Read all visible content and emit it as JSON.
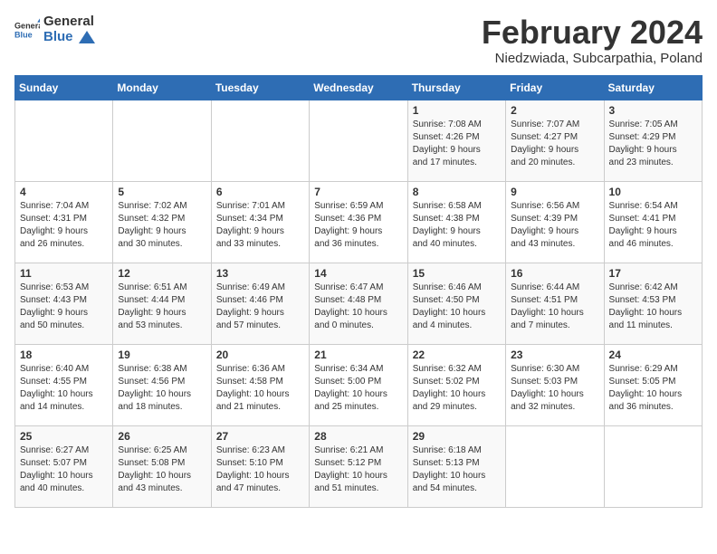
{
  "header": {
    "logo_general": "General",
    "logo_blue": "Blue",
    "month_year": "February 2024",
    "location": "Niedzwiada, Subcarpathia, Poland"
  },
  "days_of_week": [
    "Sunday",
    "Monday",
    "Tuesday",
    "Wednesday",
    "Thursday",
    "Friday",
    "Saturday"
  ],
  "weeks": [
    [
      {
        "day": "",
        "info": ""
      },
      {
        "day": "",
        "info": ""
      },
      {
        "day": "",
        "info": ""
      },
      {
        "day": "",
        "info": ""
      },
      {
        "day": "1",
        "info": "Sunrise: 7:08 AM\nSunset: 4:26 PM\nDaylight: 9 hours\nand 17 minutes."
      },
      {
        "day": "2",
        "info": "Sunrise: 7:07 AM\nSunset: 4:27 PM\nDaylight: 9 hours\nand 20 minutes."
      },
      {
        "day": "3",
        "info": "Sunrise: 7:05 AM\nSunset: 4:29 PM\nDaylight: 9 hours\nand 23 minutes."
      }
    ],
    [
      {
        "day": "4",
        "info": "Sunrise: 7:04 AM\nSunset: 4:31 PM\nDaylight: 9 hours\nand 26 minutes."
      },
      {
        "day": "5",
        "info": "Sunrise: 7:02 AM\nSunset: 4:32 PM\nDaylight: 9 hours\nand 30 minutes."
      },
      {
        "day": "6",
        "info": "Sunrise: 7:01 AM\nSunset: 4:34 PM\nDaylight: 9 hours\nand 33 minutes."
      },
      {
        "day": "7",
        "info": "Sunrise: 6:59 AM\nSunset: 4:36 PM\nDaylight: 9 hours\nand 36 minutes."
      },
      {
        "day": "8",
        "info": "Sunrise: 6:58 AM\nSunset: 4:38 PM\nDaylight: 9 hours\nand 40 minutes."
      },
      {
        "day": "9",
        "info": "Sunrise: 6:56 AM\nSunset: 4:39 PM\nDaylight: 9 hours\nand 43 minutes."
      },
      {
        "day": "10",
        "info": "Sunrise: 6:54 AM\nSunset: 4:41 PM\nDaylight: 9 hours\nand 46 minutes."
      }
    ],
    [
      {
        "day": "11",
        "info": "Sunrise: 6:53 AM\nSunset: 4:43 PM\nDaylight: 9 hours\nand 50 minutes."
      },
      {
        "day": "12",
        "info": "Sunrise: 6:51 AM\nSunset: 4:44 PM\nDaylight: 9 hours\nand 53 minutes."
      },
      {
        "day": "13",
        "info": "Sunrise: 6:49 AM\nSunset: 4:46 PM\nDaylight: 9 hours\nand 57 minutes."
      },
      {
        "day": "14",
        "info": "Sunrise: 6:47 AM\nSunset: 4:48 PM\nDaylight: 10 hours\nand 0 minutes."
      },
      {
        "day": "15",
        "info": "Sunrise: 6:46 AM\nSunset: 4:50 PM\nDaylight: 10 hours\nand 4 minutes."
      },
      {
        "day": "16",
        "info": "Sunrise: 6:44 AM\nSunset: 4:51 PM\nDaylight: 10 hours\nand 7 minutes."
      },
      {
        "day": "17",
        "info": "Sunrise: 6:42 AM\nSunset: 4:53 PM\nDaylight: 10 hours\nand 11 minutes."
      }
    ],
    [
      {
        "day": "18",
        "info": "Sunrise: 6:40 AM\nSunset: 4:55 PM\nDaylight: 10 hours\nand 14 minutes."
      },
      {
        "day": "19",
        "info": "Sunrise: 6:38 AM\nSunset: 4:56 PM\nDaylight: 10 hours\nand 18 minutes."
      },
      {
        "day": "20",
        "info": "Sunrise: 6:36 AM\nSunset: 4:58 PM\nDaylight: 10 hours\nand 21 minutes."
      },
      {
        "day": "21",
        "info": "Sunrise: 6:34 AM\nSunset: 5:00 PM\nDaylight: 10 hours\nand 25 minutes."
      },
      {
        "day": "22",
        "info": "Sunrise: 6:32 AM\nSunset: 5:02 PM\nDaylight: 10 hours\nand 29 minutes."
      },
      {
        "day": "23",
        "info": "Sunrise: 6:30 AM\nSunset: 5:03 PM\nDaylight: 10 hours\nand 32 minutes."
      },
      {
        "day": "24",
        "info": "Sunrise: 6:29 AM\nSunset: 5:05 PM\nDaylight: 10 hours\nand 36 minutes."
      }
    ],
    [
      {
        "day": "25",
        "info": "Sunrise: 6:27 AM\nSunset: 5:07 PM\nDaylight: 10 hours\nand 40 minutes."
      },
      {
        "day": "26",
        "info": "Sunrise: 6:25 AM\nSunset: 5:08 PM\nDaylight: 10 hours\nand 43 minutes."
      },
      {
        "day": "27",
        "info": "Sunrise: 6:23 AM\nSunset: 5:10 PM\nDaylight: 10 hours\nand 47 minutes."
      },
      {
        "day": "28",
        "info": "Sunrise: 6:21 AM\nSunset: 5:12 PM\nDaylight: 10 hours\nand 51 minutes."
      },
      {
        "day": "29",
        "info": "Sunrise: 6:18 AM\nSunset: 5:13 PM\nDaylight: 10 hours\nand 54 minutes."
      },
      {
        "day": "",
        "info": ""
      },
      {
        "day": "",
        "info": ""
      }
    ]
  ]
}
